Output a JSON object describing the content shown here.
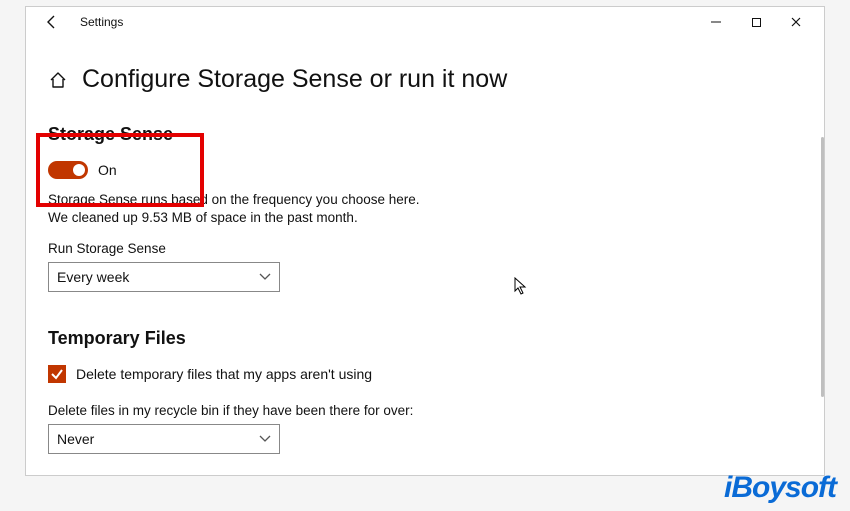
{
  "titlebar": {
    "app_name": "Settings"
  },
  "header": {
    "page_title": "Configure Storage Sense or run it now"
  },
  "storage_sense": {
    "heading": "Storage Sense",
    "toggle_state": "On",
    "description": "Storage Sense runs based on the frequency you choose here. We cleaned up 9.53 MB of space in the past month.",
    "run_label": "Run Storage Sense",
    "run_value": "Every week"
  },
  "temp_files": {
    "heading": "Temporary Files",
    "checkbox_label": "Delete temporary files that my apps aren't using",
    "recycle_label": "Delete files in my recycle bin if they have been there for over:",
    "recycle_value": "Never"
  },
  "watermark": "iBoysoft"
}
